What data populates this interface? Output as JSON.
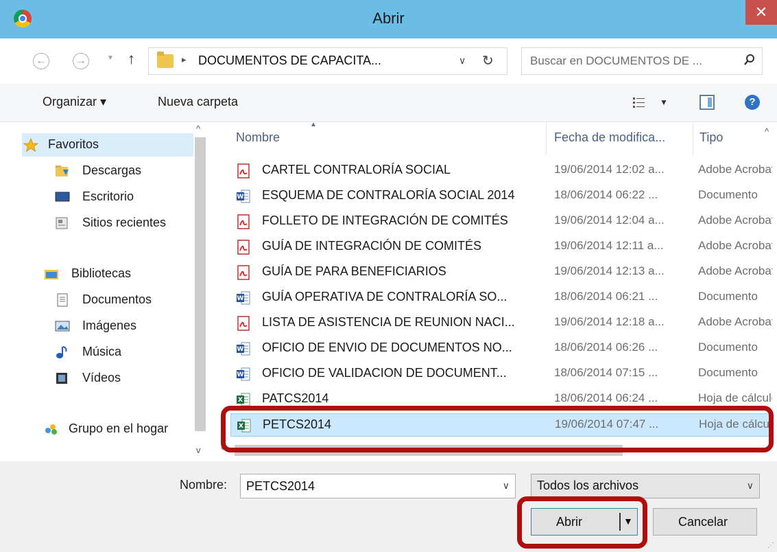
{
  "window": {
    "title": "Abrir",
    "close_glyph": "✕"
  },
  "address": {
    "path": "DOCUMENTOS DE CAPACITA...",
    "search_placeholder": "Buscar en DOCUMENTOS DE ...",
    "back_glyph": "←",
    "forward_glyph": "→",
    "up_glyph": "↑",
    "dropdown_glyph": "∨",
    "refresh_glyph": "↻",
    "breadcrumb_sep": "▸"
  },
  "toolbar": {
    "organize_label": "Organizar ▾",
    "new_folder_label": "Nueva carpeta",
    "views_dropdown_glyph": "▼",
    "help_glyph": "?"
  },
  "nav": {
    "items": [
      {
        "label": "Favoritos",
        "icon": "star-icon"
      },
      {
        "label": "Descargas",
        "icon": "downloads-folder-icon"
      },
      {
        "label": "Escritorio",
        "icon": "desktop-icon"
      },
      {
        "label": "Sitios recientes",
        "icon": "recent-places-icon"
      },
      {
        "label": "Bibliotecas",
        "icon": "libraries-icon"
      },
      {
        "label": "Documentos",
        "icon": "document-icon"
      },
      {
        "label": "Imágenes",
        "icon": "image-icon"
      },
      {
        "label": "Música",
        "icon": "music-icon"
      },
      {
        "label": "Vídeos",
        "icon": "video-icon"
      },
      {
        "label": "Grupo en el hogar",
        "icon": "homegroup-icon"
      }
    ]
  },
  "files": {
    "columns": {
      "name": "Nombre",
      "date": "Fecha de modifica...",
      "type": "Tipo"
    },
    "rows": [
      {
        "name": "CARTEL CONTRALORÍA SOCIAL",
        "date": "19/06/2014 12:02 a...",
        "type": "Adobe Acrobat",
        "icon": "pdf-icon"
      },
      {
        "name": "ESQUEMA DE CONTRALORÍA SOCIAL 2014",
        "date": "18/06/2014 06:22 ...",
        "type": "Documento",
        "icon": "word-icon"
      },
      {
        "name": "FOLLETO DE INTEGRACIÓN DE COMITÉS",
        "date": "19/06/2014 12:04 a...",
        "type": "Adobe Acrobat",
        "icon": "pdf-icon"
      },
      {
        "name": "GUÍA DE INTEGRACIÓN DE COMITÉS",
        "date": "19/06/2014 12:11 a...",
        "type": "Adobe Acrobat",
        "icon": "pdf-icon"
      },
      {
        "name": "GUÍA DE PARA BENEFICIARIOS",
        "date": "19/06/2014 12:13 a...",
        "type": "Adobe Acrobat",
        "icon": "pdf-icon"
      },
      {
        "name": "GUÍA OPERATIVA DE CONTRALORÍA SO...",
        "date": "18/06/2014 06:21 ...",
        "type": "Documento",
        "icon": "word-icon"
      },
      {
        "name": "LISTA DE ASISTENCIA DE REUNION NACI...",
        "date": "19/06/2014 12:18 a...",
        "type": "Adobe Acrobat",
        "icon": "pdf-icon"
      },
      {
        "name": "OFICIO DE ENVIO DE DOCUMENTOS NO...",
        "date": "18/06/2014 06:26 ...",
        "type": "Documento",
        "icon": "word-icon"
      },
      {
        "name": "OFICIO DE VALIDACION DE DOCUMENT...",
        "date": "18/06/2014 07:15 ...",
        "type": "Documento",
        "icon": "word-icon"
      },
      {
        "name": "PATCS2014",
        "date": "18/06/2014 06:24 ...",
        "type": "Hoja de cálculo",
        "icon": "excel-icon"
      },
      {
        "name": "PETCS2014",
        "date": "19/06/2014 07:47 ...",
        "type": "Hoja de cálculo",
        "icon": "excel-icon",
        "selected": true
      }
    ]
  },
  "footer": {
    "filename_label": "Nombre:",
    "filename_value": "PETCS2014",
    "filetype_value": "Todos los archivos",
    "open_label": "Abrir",
    "cancel_label": "Cancelar",
    "dropdown_glyph": "∨"
  },
  "colors": {
    "titlebar": "#6bbde6",
    "close": "#c7504a",
    "highlight": "#b00d0d",
    "selection": "#cce8ff"
  }
}
